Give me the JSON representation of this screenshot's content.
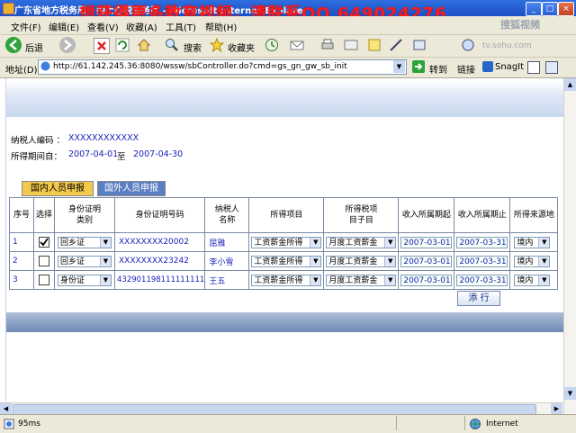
{
  "window": {
    "title": "广东省地方税务局 - 网上办税服务厅 - Microsoft Internet Explorer",
    "watermark_overlay": "想获得更多教育视频，请联系QQ  649024276",
    "corner_logo": "搜狐视频",
    "corner_url": "tv.sohu.com"
  },
  "menu": [
    "文件(F)",
    "编辑(E)",
    "查看(V)",
    "收藏(A)",
    "工具(T)",
    "帮助(H)"
  ],
  "toolbar": {
    "back_label": "后退",
    "search_label": "搜索",
    "favorites_label": "收藏夹"
  },
  "address": {
    "label": "地址(D)",
    "url": "http://61.142.245.36:8080/wssw/sbController.do?cmd=gs_gn_gw_sb_init",
    "go_label": "转到",
    "links_label": "链接",
    "snagit_label": "SnagIt"
  },
  "form": {
    "taxpayer_code_label": "纳税人编码 ：",
    "taxpayer_code": "XXXXXXXXXXXX",
    "period_label": "所得期间自：",
    "period_from": "2007-04-01",
    "period_to_label": "至",
    "period_to": "2007-04-30"
  },
  "tabs": [
    {
      "label": "国内人员申报",
      "active": false
    },
    {
      "label": "国外人员申报",
      "active": true
    }
  ],
  "table": {
    "headers": [
      "序号",
      "选择",
      "身份证明\n类别",
      "身份证明号码",
      "纳税人\n名称",
      "所得项目",
      "所得税项\n目子目",
      "收入所属期起",
      "收入所属期止",
      "所得来源地"
    ],
    "rows": [
      {
        "no": "1",
        "checked": true,
        "id_type": "回乡证",
        "id_number": "XXXXXXXX20002",
        "name": "屈雅",
        "income_item": "工资薪金所得",
        "sub_item": "月度工资薪金",
        "start": "2007-03-01",
        "end": "2007-03-31",
        "source": "境内"
      },
      {
        "no": "2",
        "checked": false,
        "id_type": "回乡证",
        "id_number": "XXXXXXXX23242",
        "name": "李小雪",
        "income_item": "工资薪金所得",
        "sub_item": "月度工资薪金",
        "start": "2007-03-01",
        "end": "2007-03-31",
        "source": "境内"
      },
      {
        "no": "3",
        "checked": false,
        "id_type": "身份证",
        "id_number": "432901198111111111",
        "name": "王五",
        "income_item": "工资薪金所得",
        "sub_item": "月度工资薪金",
        "start": "2007-03-01",
        "end": "2007-03-31",
        "source": "境内"
      }
    ]
  },
  "add_row_label": "添 行",
  "status": {
    "progress_text": "95ms",
    "zone_label": "Internet"
  },
  "colors": {
    "titlebar": "#1d4fc4",
    "watermark": "#ff1b1b",
    "link_blue": "#1a22b8",
    "active_tab": "#5b7fc4",
    "inactive_tab": "#f2c94c"
  }
}
